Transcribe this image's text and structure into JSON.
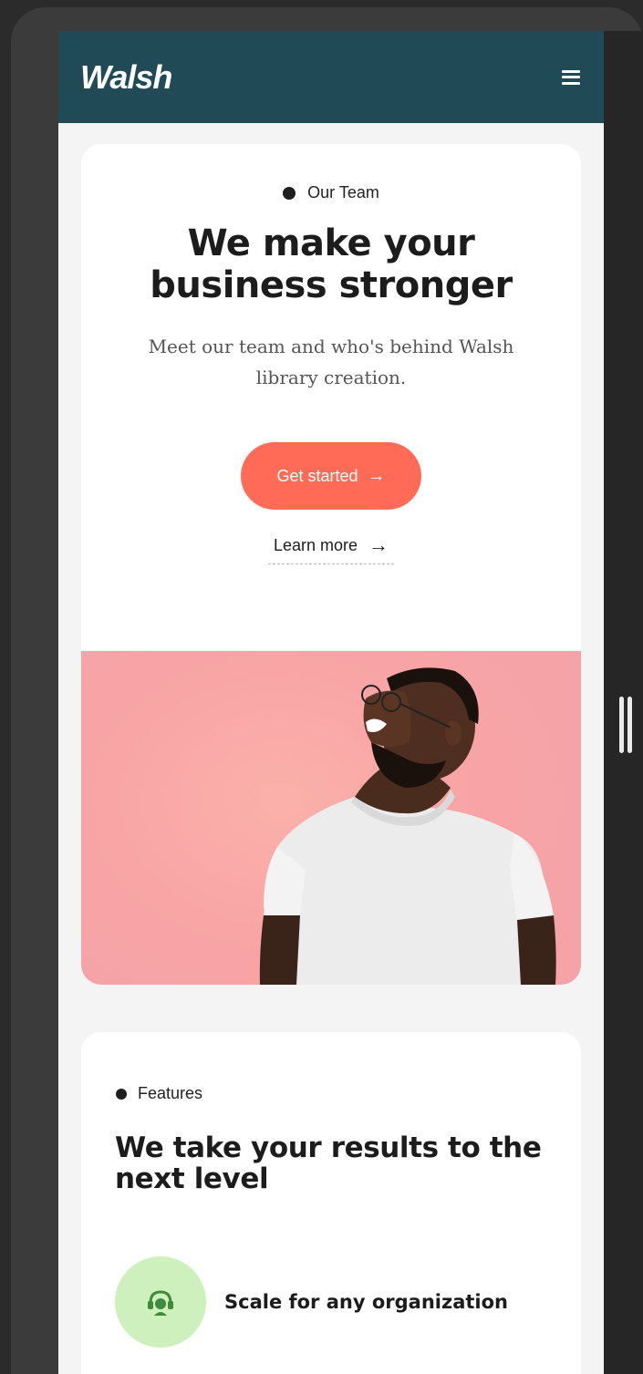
{
  "nav": {
    "logo": "Walsh",
    "menu_icon": "hamburger-menu-icon",
    "background": "#1f4a56"
  },
  "hero": {
    "eyebrow": "Our Team",
    "title_line1": "We make your",
    "title_line2": "business stronger",
    "subtitle": "Meet our team and who's behind Walsh library creation.",
    "cta_label": "Get started",
    "cta_icon": "arrow-right-icon",
    "cta_color": "#ff6b57",
    "learn_label": "Learn more",
    "learn_icon": "arrow-right-icon",
    "image_background": "#f9a5a6"
  },
  "features": {
    "eyebrow": "Features",
    "title": "We take your results to the next level",
    "items": [
      {
        "icon": "headset-support-icon",
        "label": "Scale for any organization",
        "badge_color": "#cdf0bd"
      }
    ]
  }
}
